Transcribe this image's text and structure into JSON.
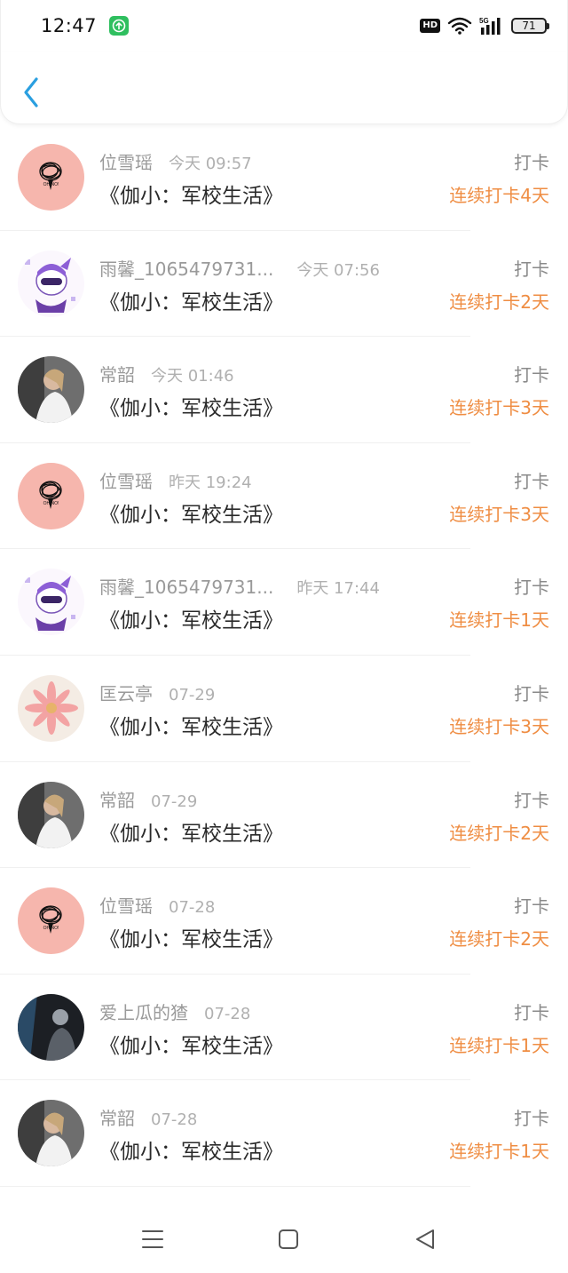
{
  "status": {
    "time": "12:47",
    "hd": "HD",
    "battery": "71"
  },
  "rows": [
    {
      "name": "位雪瑶",
      "time": "今天 09:57",
      "book": "《伽小：军校生活》",
      "action": "打卡",
      "streak": "连续打卡4天",
      "avatar": "oh-no"
    },
    {
      "name": "雨馨_1065479731...",
      "time": "今天 07:56",
      "book": "《伽小：军校生活》",
      "action": "打卡",
      "streak": "连续打卡2天",
      "avatar": "cartoon"
    },
    {
      "name": "常韶",
      "time": "今天 01:46",
      "book": "《伽小：军校生活》",
      "action": "打卡",
      "streak": "连续打卡3天",
      "avatar": "photo"
    },
    {
      "name": "位雪瑶",
      "time": "昨天 19:24",
      "book": "《伽小：军校生活》",
      "action": "打卡",
      "streak": "连续打卡3天",
      "avatar": "oh-no"
    },
    {
      "name": "雨馨_1065479731...",
      "time": "昨天 17:44",
      "book": "《伽小：军校生活》",
      "action": "打卡",
      "streak": "连续打卡1天",
      "avatar": "cartoon"
    },
    {
      "name": "匡云亭",
      "time": "07-29",
      "book": "《伽小：军校生活》",
      "action": "打卡",
      "streak": "连续打卡3天",
      "avatar": "flower"
    },
    {
      "name": "常韶",
      "time": "07-29",
      "book": "《伽小：军校生活》",
      "action": "打卡",
      "streak": "连续打卡2天",
      "avatar": "photo"
    },
    {
      "name": "位雪瑶",
      "time": "07-28",
      "book": "《伽小：军校生活》",
      "action": "打卡",
      "streak": "连续打卡2天",
      "avatar": "oh-no"
    },
    {
      "name": "爱上瓜的猹",
      "time": "07-28",
      "book": "《伽小：军校生活》",
      "action": "打卡",
      "streak": "连续打卡1天",
      "avatar": "dark-photo"
    },
    {
      "name": "常韶",
      "time": "07-28",
      "book": "《伽小：军校生活》",
      "action": "打卡",
      "streak": "连续打卡1天",
      "avatar": "photo"
    }
  ],
  "colors": {
    "accent": "#2a9fe0",
    "streak": "#ef8d43",
    "upload": "#2fbf5f"
  }
}
